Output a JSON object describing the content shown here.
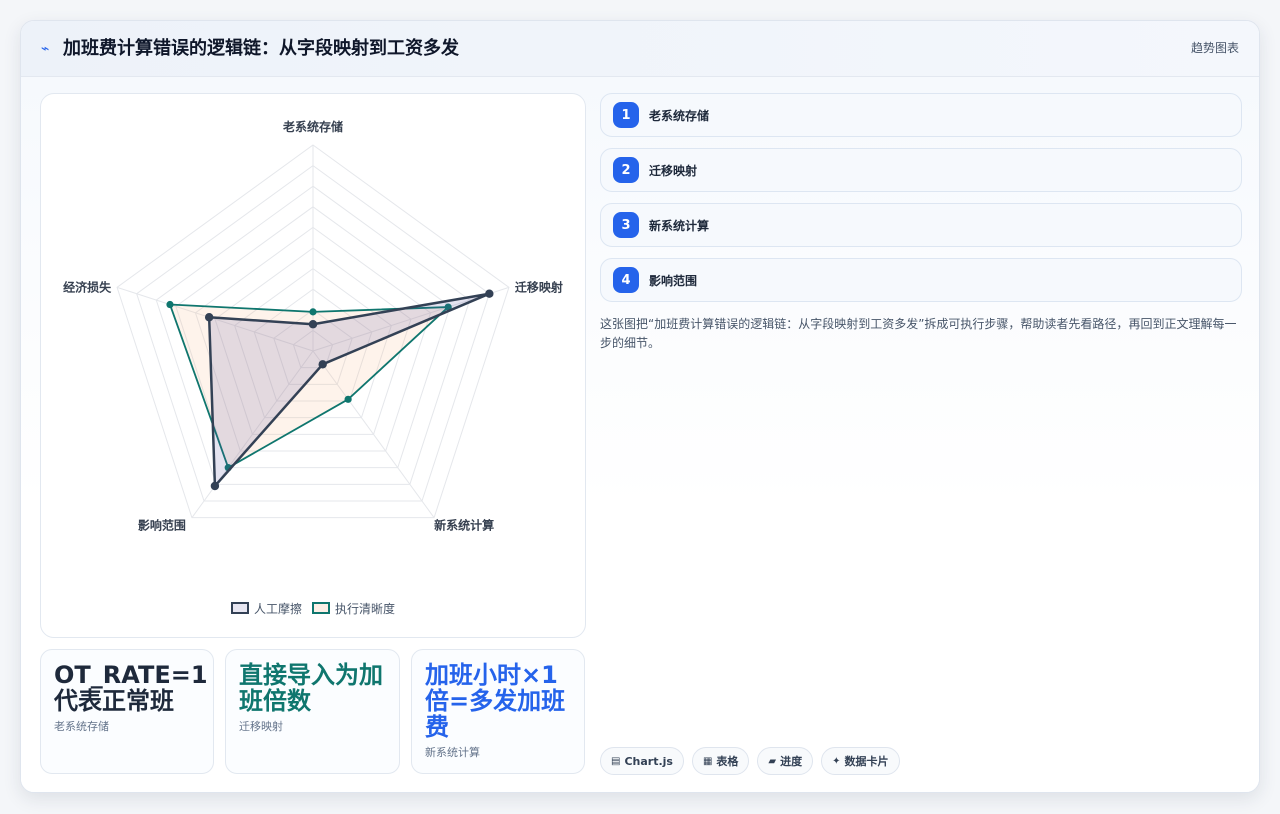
{
  "header": {
    "title": "加班费计算错误的逻辑链：从字段映射到工资多发",
    "tag": "趋势图表"
  },
  "steps": [
    {
      "num": "1",
      "label": "老系统存储"
    },
    {
      "num": "2",
      "label": "迁移映射"
    },
    {
      "num": "3",
      "label": "新系统计算"
    },
    {
      "num": "4",
      "label": "影响范围"
    }
  ],
  "description": "这张图把“加班费计算错误的逻辑链：从字段映射到工资多发”拆成可执行步骤，帮助读者先看路径，再回到正文理解每一步的细节。",
  "stats": [
    {
      "value": "OT_RATE=1代表正常班",
      "label": "老系统存储",
      "color": "#1e293b"
    },
    {
      "value": "直接导入为加班倍数",
      "label": "迁移映射",
      "color": "#0f766e"
    },
    {
      "value": "加班小时×1倍=多发加班费",
      "label": "新系统计算",
      "color": "#2563eb"
    }
  ],
  "chips": [
    {
      "icon": "chart-icon",
      "label": "Chart.js"
    },
    {
      "icon": "table-icon",
      "label": "表格"
    },
    {
      "icon": "progress-icon",
      "label": "进度"
    },
    {
      "icon": "card-icon",
      "label": "数据卡片"
    }
  ],
  "chart_data": {
    "type": "radar",
    "categories": [
      "老系统存储",
      "迁移映射",
      "新系统计算",
      "影响范围",
      "经济损失"
    ],
    "range": [
      0,
      10
    ],
    "grid": true,
    "legend_position": "bottom",
    "series": [
      {
        "name": "人工摩擦",
        "values": [
          1.3,
          9.0,
          0.8,
          8.1,
          5.3
        ],
        "stroke": "#334155",
        "fill": "rgba(88,80,160,0.16)"
      },
      {
        "name": "执行清晰度",
        "values": [
          1.9,
          6.9,
          2.9,
          7.0,
          7.3
        ],
        "stroke": "#0f766e",
        "fill": "rgba(249,180,130,0.16)"
      }
    ]
  }
}
